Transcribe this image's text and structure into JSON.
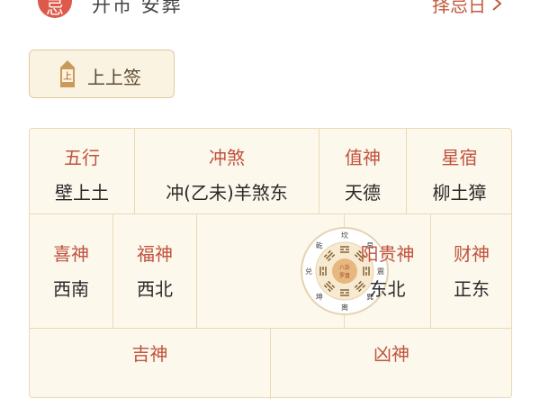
{
  "top": {
    "badge": "忌",
    "left_text": "开市 安葬",
    "right_link": "择忌日",
    "chevron": "chevron-right-icon"
  },
  "lot": {
    "label": "上上签",
    "icon_char": "上"
  },
  "row1": [
    {
      "title": "五行",
      "value": "壁上土"
    },
    {
      "title": "冲煞",
      "value": "冲(乙未)羊煞东"
    },
    {
      "title": "值神",
      "value": "天德"
    },
    {
      "title": "星宿",
      "value": "柳土獐"
    }
  ],
  "row2": {
    "xishen": {
      "title": "喜神",
      "value": "西南"
    },
    "fushen": {
      "title": "福神",
      "value": "西北"
    },
    "yanggui": {
      "title": "阳贵神",
      "value": "东北"
    },
    "caishen": {
      "title": "财神",
      "value": "正东"
    }
  },
  "row3": {
    "jishen_title": "吉神",
    "xiongshen_title": "凶神"
  },
  "bagua": {
    "center": [
      "八卦",
      "罗盘"
    ],
    "labels": [
      "坎",
      "艮",
      "震",
      "巽",
      "离",
      "坤",
      "兑",
      "乾"
    ]
  },
  "colors": {
    "accent": "#c0523e",
    "badge": "#dd5a4a",
    "grid_bg": "#fdf8ec",
    "border": "#ead9b8"
  }
}
